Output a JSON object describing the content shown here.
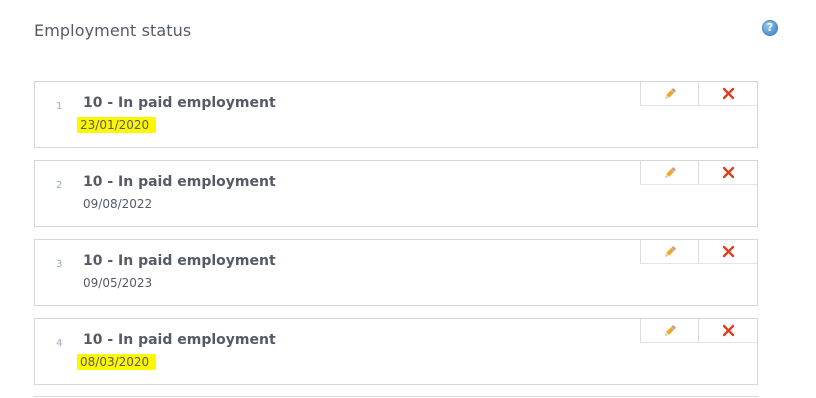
{
  "section": {
    "title": "Employment status",
    "help_icon": "help-question-icon"
  },
  "entries": [
    {
      "index": "1",
      "status": "10 - In paid employment",
      "date": "23/01/2020",
      "highlighted": true
    },
    {
      "index": "2",
      "status": "10 - In paid employment",
      "date": "09/08/2022",
      "highlighted": false
    },
    {
      "index": "3",
      "status": "10 - In paid employment",
      "date": "09/05/2023",
      "highlighted": false
    },
    {
      "index": "4",
      "status": "10 - In paid employment",
      "date": "08/03/2020",
      "highlighted": true
    }
  ],
  "icons": {
    "edit": "pencil-icon",
    "delete": "close-x-icon"
  },
  "colors": {
    "highlight": "#fff700",
    "delete": "#e23b1a",
    "help": "#5b9bd3"
  }
}
